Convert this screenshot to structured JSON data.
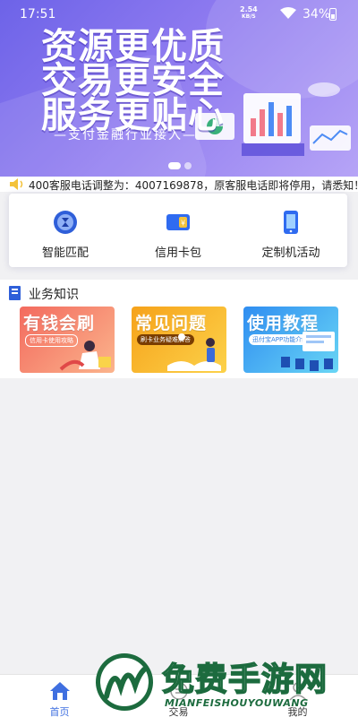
{
  "status_bar": {
    "time": "17:51",
    "net_speed": "2.54",
    "net_unit": "KB/S",
    "battery": "34%"
  },
  "banner": {
    "line1": "资源更优质",
    "line2": "交易更安全",
    "line3": "服务更贴心",
    "subline": "—支付金融行业接入—",
    "slides": 2,
    "active_slide": 0
  },
  "notice": {
    "text": "400客服电话调整为：4007169878，原客服电话即将停用，请悉知！"
  },
  "quick_actions": [
    {
      "label": "智能匹配",
      "icon": "hourglass-icon"
    },
    {
      "label": "信用卡包",
      "icon": "card-yen-icon"
    },
    {
      "label": "定制机活动",
      "icon": "phone-icon"
    }
  ],
  "knowledge": {
    "title": "业务知识",
    "cards": [
      {
        "title": "有钱会刷",
        "tag": "信用卡使用攻略",
        "color": "#f36a5e"
      },
      {
        "title": "常见问题",
        "tag": "刷卡业务疑难解答",
        "color": "#f6a21a"
      },
      {
        "title": "使用教程",
        "tag": "迅付宝APP功能介绍",
        "color": "#2f8df1"
      }
    ]
  },
  "bottom_nav": [
    {
      "label": "首页",
      "icon": "home-icon",
      "active": true
    },
    {
      "label": "交易",
      "icon": "transaction-icon",
      "active": false
    },
    {
      "label": "我的",
      "icon": "profile-icon",
      "active": false
    }
  ],
  "watermark": {
    "title": "免费手游网",
    "subtitle": "MIANFEISHOUYOUWANG"
  },
  "colors": {
    "banner": "#7b6ef0",
    "accent": "#3f6fe0",
    "background": "#f1f1f3"
  }
}
